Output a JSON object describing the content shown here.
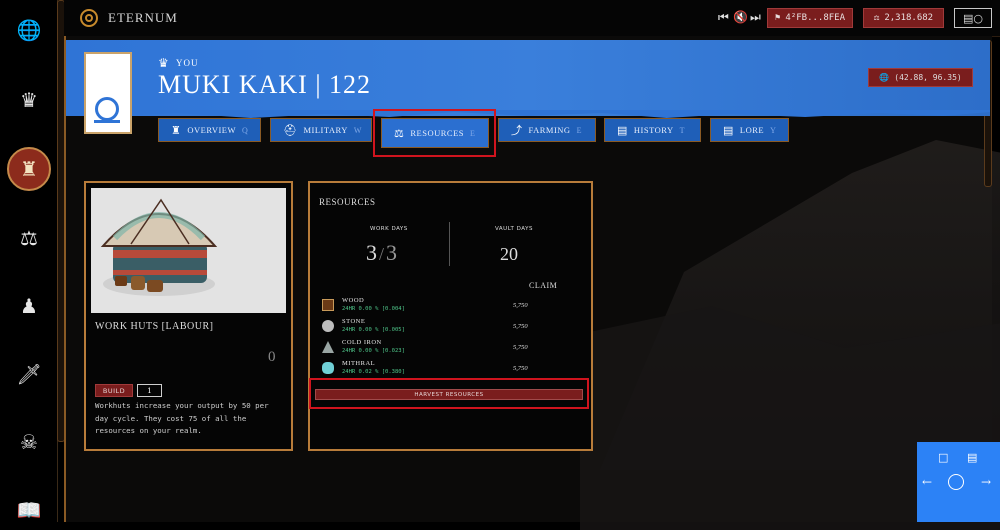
{
  "app": {
    "brand": "ETERNUM"
  },
  "rail": {
    "items": [
      "globe-icon",
      "crown-icon",
      "castle-icon",
      "balance-icon",
      "army-icon",
      "sword-icon",
      "skull-icon",
      "book-icon"
    ],
    "active": "castle-icon"
  },
  "topbar": {
    "account": "4²FB...8FEA",
    "balance": "2,318.682"
  },
  "realm": {
    "owner_label": "YOU",
    "name": "MUKI KAKI | 122",
    "coords": "(42.88, 96.35)"
  },
  "tabs": [
    {
      "label": "OVERVIEW",
      "key": "Q",
      "icon": "castle-icon"
    },
    {
      "label": "MILITARY",
      "key": "W",
      "icon": "helmet-icon"
    },
    {
      "label": "RESOURCES",
      "key": "E",
      "icon": "balance-icon",
      "active": true
    },
    {
      "label": "FARMING",
      "key": "E",
      "icon": "scythe-icon"
    },
    {
      "label": "HISTORY",
      "key": "T",
      "icon": "scroll-icon"
    },
    {
      "label": "LORE",
      "key": "Y",
      "icon": "scroll-icon"
    }
  ],
  "work_huts": {
    "title": "WORK HUTS [LABOUR]",
    "count": "0",
    "build_label": "BUILD",
    "quantity": "1",
    "description": "Workhuts increase your output by 50 per day cycle. They cost 75 of all the resources on your realm."
  },
  "resources": {
    "title": "RESOURCES",
    "work_days_label": "WORK DAYS",
    "work_days_current": "3",
    "work_days_total": "3",
    "vault_days_label": "VAULT DAYS",
    "vault_days": "20",
    "claim_label": "CLAIM",
    "items": [
      {
        "name": "WOOD",
        "rate": "24HR 0.00 % [0.004]",
        "claim": "5,750",
        "color": "#6b3a16"
      },
      {
        "name": "STONE",
        "rate": "24HR 0.00 % [0.005]",
        "claim": "5,750",
        "color": "#bdbdbd"
      },
      {
        "name": "COLD IRON",
        "rate": "24HR 0.00 % [0.023]",
        "claim": "5,750",
        "color": "#9aa6a4"
      },
      {
        "name": "MITHRAL",
        "rate": "24HR 0.02 % [0.380]",
        "claim": "5,750",
        "color": "#6fd0d6"
      }
    ],
    "harvest_label": "HARVEST RESOURCES"
  },
  "colors": {
    "accent_blue": "#2f74d6",
    "accent_red": "#7a1d1d",
    "border_gold": "#b87c3a",
    "highlight": "#d0141e"
  }
}
